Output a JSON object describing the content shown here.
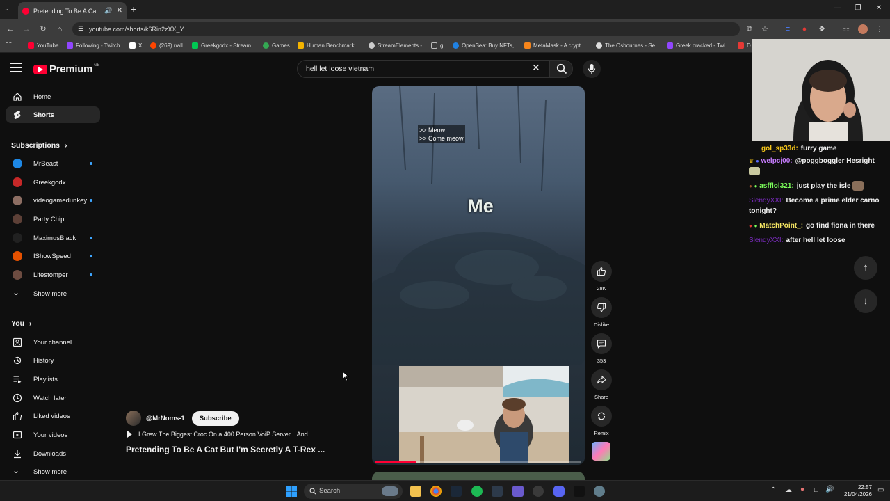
{
  "browser": {
    "tab_title": "Pretending To Be A Cat But I'm Secretly A T-Rex",
    "url": "youtube.com/shorts/k6Rin2zXX_Y",
    "bookmarks": [
      {
        "label": "YouTube",
        "color": "#ff0033"
      },
      {
        "label": "Following - Twitch",
        "color": "#9146ff"
      },
      {
        "label": "X",
        "color": "#ffffff"
      },
      {
        "label": "(269) r/all",
        "color": "#ff4500"
      },
      {
        "label": "Greekgodx - Stream...",
        "color": "#00c853"
      },
      {
        "label": "Games",
        "color": "#34a853"
      },
      {
        "label": "Human Benchmark...",
        "color": "#f5b400"
      },
      {
        "label": "StreamElements -",
        "color": "#cccccc"
      },
      {
        "label": "g",
        "color": "#888888"
      },
      {
        "label": "OpenSea: Buy NFTs,...",
        "color": "#2081e2"
      },
      {
        "label": "MetaMask - A crypt...",
        "color": "#f6851b"
      },
      {
        "label": "The Osbournes - Se...",
        "color": "#dddddd"
      },
      {
        "label": "Greek cracked - Twi...",
        "color": "#9146ff"
      },
      {
        "label": "D",
        "color": "#e53935"
      }
    ]
  },
  "youtube": {
    "logo_text": "Premium",
    "logo_region": "GB",
    "search_query": "hell let loose vietnam",
    "nav": {
      "home": "Home",
      "shorts": "Shorts",
      "subscriptions": "Subscriptions",
      "show_more_1": "Show more",
      "you": "You",
      "your_channel": "Your channel",
      "history": "History",
      "playlists": "Playlists",
      "watch_later": "Watch later",
      "liked_videos": "Liked videos",
      "your_videos": "Your videos",
      "downloads": "Downloads",
      "show_more_2": "Show more"
    },
    "subscriptions": [
      {
        "name": "MrBeast",
        "dot": true,
        "color": "#1e88e5"
      },
      {
        "name": "Greekgodx",
        "dot": false,
        "color": "#c62828"
      },
      {
        "name": "videogamedunkey",
        "dot": true,
        "color": "#8d6e63"
      },
      {
        "name": "Party Chip",
        "dot": false,
        "color": "#5d4037"
      },
      {
        "name": "MaximusBlack",
        "dot": true,
        "color": "#212121"
      },
      {
        "name": "IShowSpeed",
        "dot": true,
        "color": "#e65100"
      },
      {
        "name": "Lifestomper",
        "dot": true,
        "color": "#6d4c41"
      }
    ],
    "short": {
      "caption_line1": ">> Meow.",
      "caption_line2": ">> Come meow",
      "overlay_word": "Me",
      "progress": 0.2,
      "channel": "@MrNoms-1",
      "subscribe": "Subscribe",
      "playlist_line": "I Grew The Biggest Croc On a 400 Person VoiP Server... And",
      "title": "Pretending To Be A Cat But I'm Secretly A T-Rex ...",
      "likes": "28K",
      "dislike": "Dislike",
      "comments": "353",
      "share": "Share",
      "remix": "Remix"
    }
  },
  "chat": [
    {
      "user": "gol_sp33d:",
      "text": "furry game",
      "color": "#f5c518"
    },
    {
      "user": "welpcj00:",
      "text": "@poggboggler Hesright",
      "color": "#c77dff"
    },
    {
      "user": "asfflol321:",
      "text": "just play the isle",
      "color": "#7cff5b"
    },
    {
      "user": "SlendyXXI:",
      "text": "Become a prime elder carno tonight?",
      "color": "#7b2cbf"
    },
    {
      "user": "MatchPoint_:",
      "text": "go find fiona in there",
      "color": "#f5e663"
    },
    {
      "user": "SlendyXXI:",
      "text": "after hell let loose",
      "color": "#7b2cbf"
    }
  ],
  "taskbar": {
    "search": "Search",
    "time": "22:57",
    "date": "21/04/2026"
  }
}
